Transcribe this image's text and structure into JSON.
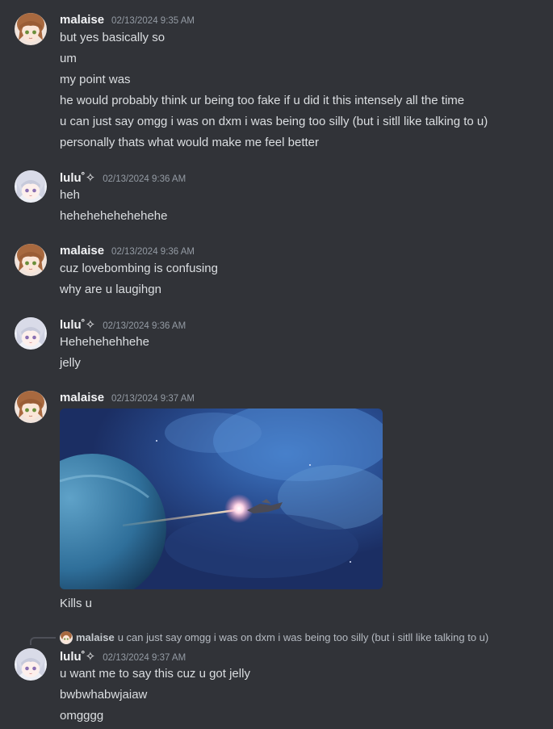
{
  "groups": [
    {
      "author": "malaise",
      "timestamp": "02/13/2024 9:35 AM",
      "lines": [
        "but yes basically so",
        "um",
        "my point was",
        "he would probably think ur being too fake if u did it this intensely all the time",
        "u can just say omgg i was on dxm i was being too silly (but i sitll like talking to u)",
        "personally thats what would make me feel better"
      ]
    },
    {
      "author": "lulu˚✧",
      "timestamp": "02/13/2024 9:36 AM",
      "lines": [
        "heh",
        "hehehehehehehehe"
      ]
    },
    {
      "author": "malaise",
      "timestamp": "02/13/2024 9:36 AM",
      "lines": [
        "cuz lovebombing is confusing",
        "why are u laugihgn"
      ]
    },
    {
      "author": "lulu˚✧",
      "timestamp": "02/13/2024 9:36 AM",
      "lines": [
        "Hehehehehhehe",
        "jelly"
      ]
    },
    {
      "author": "malaise",
      "timestamp": "02/13/2024 9:37 AM",
      "attachment": "space-battle-image",
      "lines": [
        "Kills u"
      ]
    },
    {
      "reply": {
        "author": "malaise",
        "text": "u can just say omgg i was on dxm i was being too silly (but i sitll like talking to u)"
      },
      "author": "lulu˚✧",
      "timestamp": "02/13/2024 9:37 AM",
      "lines": [
        "u want me to say this cuz u got jelly",
        "bwbwhabwjaiaw",
        "omgggg"
      ]
    }
  ],
  "colors": {
    "background": "#313338",
    "username": "#f2f3f5",
    "timestamp": "#949ba4",
    "text": "#dbdee1"
  }
}
